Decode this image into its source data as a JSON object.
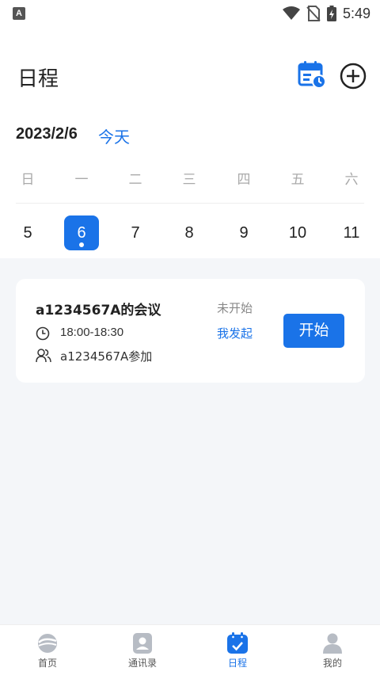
{
  "status_bar": {
    "left_badge": "A",
    "time": "5:49",
    "icons": [
      "wifi-icon",
      "no-sim-icon",
      "battery-charging-icon"
    ]
  },
  "header": {
    "title": "日程",
    "calendar_icon": "calendar-clock-icon",
    "add_icon": "add-circle-icon"
  },
  "date_bar": {
    "current_date": "2023/2/6",
    "today_label": "今天"
  },
  "week": {
    "weekdays": [
      "日",
      "一",
      "二",
      "三",
      "四",
      "五",
      "六"
    ],
    "days": [
      "5",
      "6",
      "7",
      "8",
      "9",
      "10",
      "11"
    ],
    "selected_day": "6"
  },
  "meeting": {
    "title": "a1234567A的会议",
    "time": "18:00-18:30",
    "participants": "a1234567A参加",
    "status": "未开始",
    "initiator": "我发起",
    "start_label": "开始"
  },
  "tabs": [
    {
      "label": "首页",
      "icon": "home-logo-icon",
      "active": false
    },
    {
      "label": "通讯录",
      "icon": "contacts-icon",
      "active": false
    },
    {
      "label": "日程",
      "icon": "schedule-icon",
      "active": true
    },
    {
      "label": "我的",
      "icon": "profile-icon",
      "active": false
    }
  ],
  "colors": {
    "accent": "#1a73e8",
    "background_gray": "#f4f6f9",
    "weekday_gray": "#aaaaaa"
  }
}
